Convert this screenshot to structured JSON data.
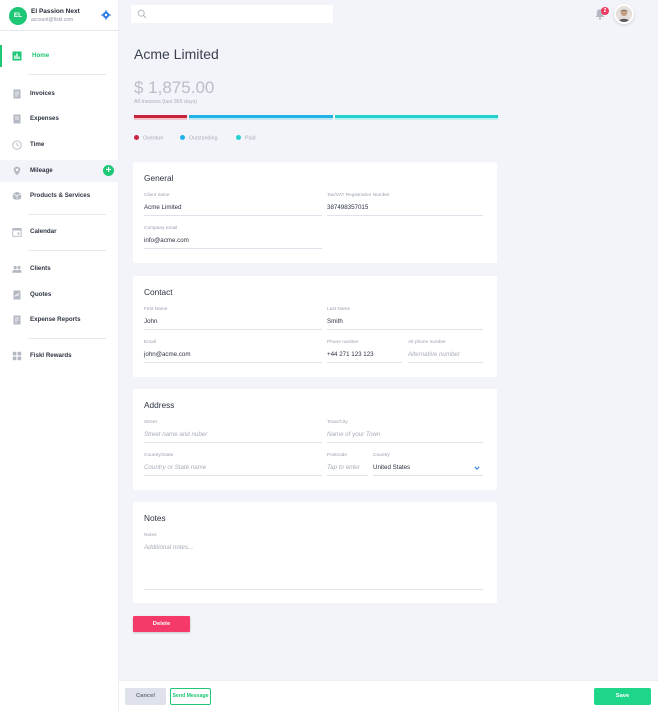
{
  "account": {
    "initials": "EL",
    "name": "El Passion Next",
    "email": "account@fiskl.com"
  },
  "nav": {
    "home": "Home",
    "invoices": "Invoices",
    "expenses": "Expenses",
    "time": "Time",
    "mileage": "Mileage",
    "products": "Products & Services",
    "calendar": "Calendar",
    "clients": "Clients",
    "quotes": "Quotes",
    "expense_reports": "Expense Reports",
    "rewards": "Fiskl Rewards"
  },
  "topbar": {
    "search_placeholder": "",
    "notification_count": "2"
  },
  "header": {
    "company": "Acme Limited",
    "amount": "$ 1,875.00",
    "amount_caption": "All Invoices (last 365 days)"
  },
  "legend": {
    "overdue": "Overdue",
    "outstanding": "Outstanding",
    "paid": "Paid"
  },
  "colors": {
    "accent": "#1ec776",
    "overdue": "#c8233f",
    "outstanding": "#21b3e6",
    "paid": "#22d2cf",
    "delete": "#f53a6a"
  },
  "general": {
    "title": "General",
    "client_name_label": "Client name",
    "client_name": "Acme Limited",
    "tax_label": "Tax/VAT Registration Number",
    "tax_value": "387498357015",
    "email_label": "Company email",
    "email_value": "info@acme.com"
  },
  "contact": {
    "title": "Contact",
    "first_name_label": "First Name",
    "first_name": "John",
    "last_name_label": "Last Name",
    "last_name": "Smith",
    "email_label": "Email",
    "email": "john@acme.com",
    "phone_label": "Phone number",
    "phone": "+44 271 123 123",
    "alt_phone_label": "Alt phone number",
    "alt_phone_placeholder": "Alternative number"
  },
  "address": {
    "title": "Address",
    "street_label": "Street",
    "street_placeholder": "Street name and nuber",
    "town_label": "Town/City",
    "town_placeholder": "Name of your Town",
    "state_label": "Country/State",
    "state_placeholder": "Country or State name",
    "postcode_label": "Postcode",
    "postcode_placeholder": "Tap to enter",
    "country_label": "Country",
    "country_value": "United States"
  },
  "notes": {
    "title": "Notes",
    "label": "Notes",
    "placeholder": "Additional notes..."
  },
  "actions": {
    "delete": "Delete",
    "cancel": "Cancel",
    "send_message": "Send Message",
    "save": "Save"
  }
}
